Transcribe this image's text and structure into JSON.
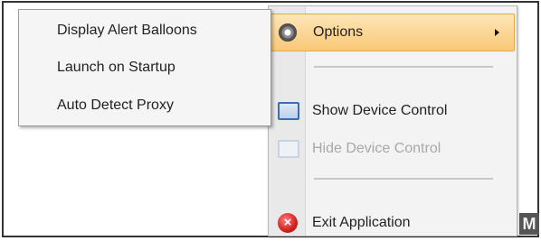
{
  "context_menu": {
    "options_label": "Options",
    "show_device_control_label": "Show Device Control",
    "hide_device_control_label": "Hide Device Control",
    "exit_application_label": "Exit Application",
    "exit_icon_glyph": "×",
    "icons": {
      "options": "gear-icon",
      "show": "device-control-icon",
      "hide": "device-control-icon",
      "exit": "exit-icon"
    },
    "highlight_color": "#f9c877",
    "disabled_text_color": "#a8a8a8"
  },
  "options_submenu": {
    "items": [
      {
        "label": "Display Alert Balloons"
      },
      {
        "label": "Launch on Startup"
      },
      {
        "label": "Auto Detect Proxy"
      }
    ]
  },
  "corner_badge": "M"
}
